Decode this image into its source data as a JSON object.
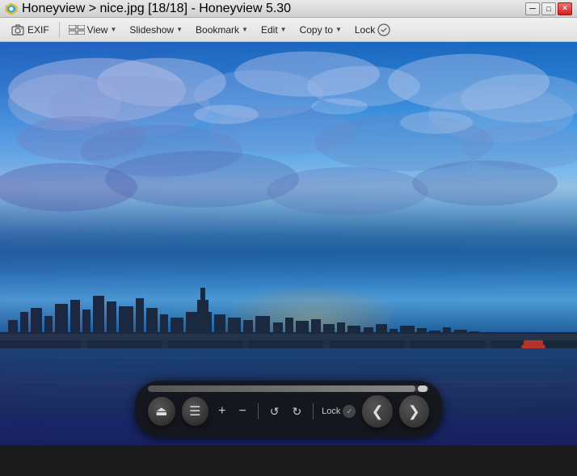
{
  "titleBar": {
    "appName": "Honeyview",
    "breadcrumb": "Honeyview > nice.jpg [18/18] - Honeyview 5.30",
    "minimize": "─",
    "maximize": "□",
    "close": "✕"
  },
  "toolbar": {
    "exif": "EXIF",
    "view": "View",
    "slideshow": "Slideshow",
    "bookmark": "Bookmark",
    "edit": "Edit",
    "copyTo": "Copy to",
    "lock": "Lock"
  },
  "controls": {
    "eject": "⏏",
    "menu": "☰",
    "zoomIn": "+",
    "zoomOut": "−",
    "rotateLeft": "↺",
    "rotateRight": "↻",
    "lockLabel": "Lock",
    "prevLabel": "❮",
    "nextLabel": "❯",
    "progressPercent": 95
  }
}
